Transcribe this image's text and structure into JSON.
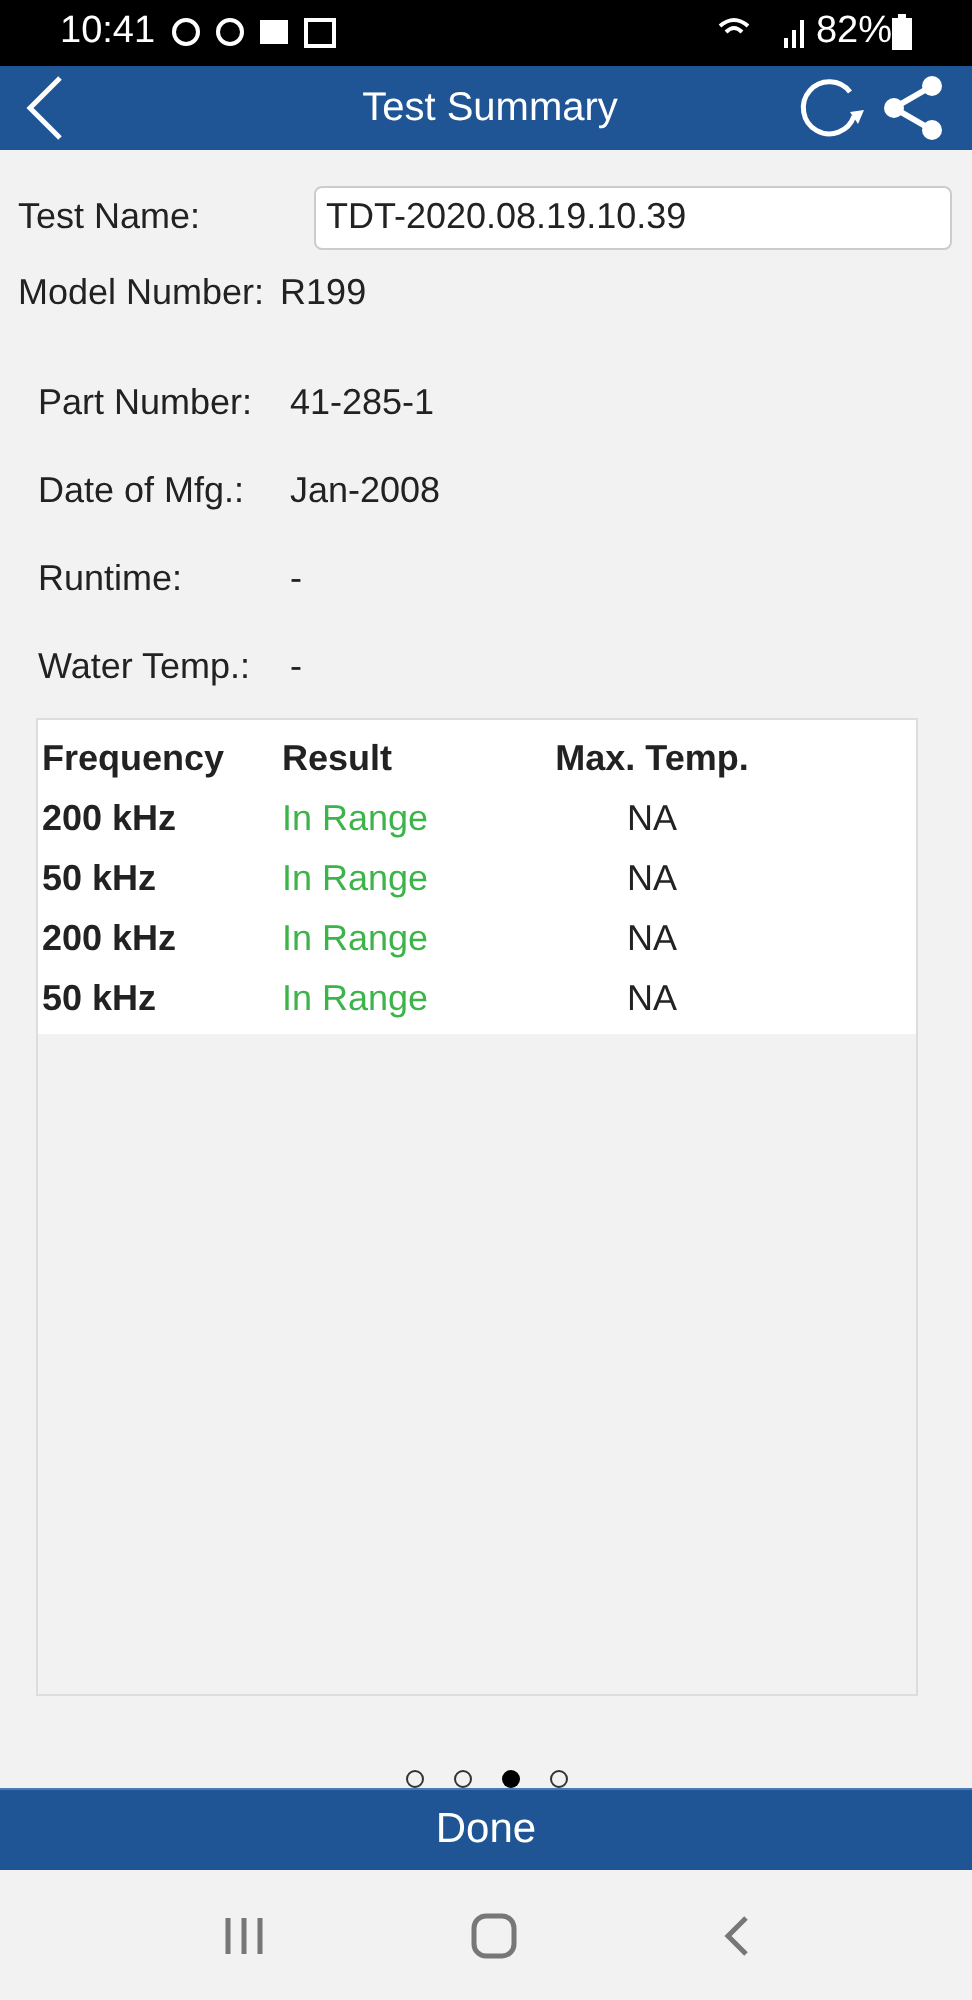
{
  "status_bar": {
    "time": "10:41",
    "battery": "82%"
  },
  "header": {
    "title": "Test Summary"
  },
  "test_name": {
    "label": "Test Name:",
    "value": "TDT-2020.08.19.10.39"
  },
  "model": {
    "label": "Model Number:",
    "value": "R199"
  },
  "details": [
    {
      "label": "Part Number:",
      "value": "41-285-1"
    },
    {
      "label": "Date of Mfg.:",
      "value": "Jan-2008"
    },
    {
      "label": "Runtime:",
      "value": "-"
    },
    {
      "label": "Water Temp.:",
      "value": "-"
    }
  ],
  "table": {
    "columns": [
      "Frequency",
      "Result",
      "Max. Temp."
    ],
    "rows": [
      [
        "200 kHz",
        "In Range",
        "NA"
      ],
      [
        "50 kHz",
        "In Range",
        "NA"
      ],
      [
        "200 kHz",
        "In Range",
        "NA"
      ],
      [
        "50 kHz",
        "In Range",
        "NA"
      ]
    ]
  },
  "pager": [
    {
      "selected": false
    },
    {
      "selected": false
    },
    {
      "selected": true
    },
    {
      "selected": false
    }
  ],
  "done_button": "Done"
}
